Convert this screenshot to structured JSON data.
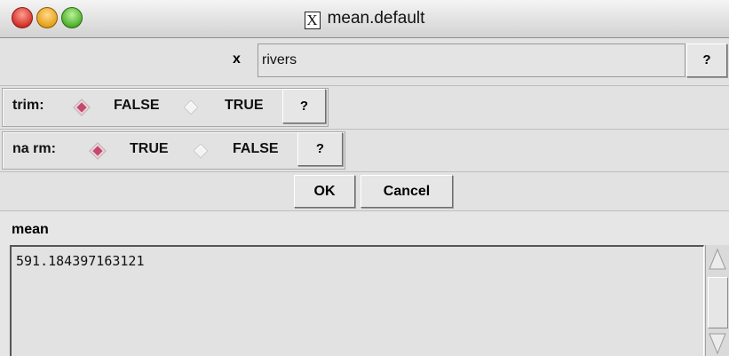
{
  "window": {
    "title": "mean.default",
    "title_icon": "X"
  },
  "x_arg": {
    "label": "x",
    "value": "rivers",
    "help_label": "?"
  },
  "trim": {
    "label": "trim:",
    "options": [
      {
        "label": "FALSE",
        "selected": true
      },
      {
        "label": "TRUE",
        "selected": false
      }
    ],
    "help_label": "?"
  },
  "na_rm": {
    "label": "na rm:",
    "options": [
      {
        "label": "TRUE",
        "selected": true
      },
      {
        "label": "FALSE",
        "selected": false
      }
    ],
    "help_label": "?"
  },
  "actions": {
    "ok_label": "OK",
    "cancel_label": "Cancel"
  },
  "result": {
    "label": "mean",
    "value": "591.184397163121"
  },
  "colors": {
    "radio_selected": "#c14a6d",
    "background": "#e2e2e2"
  }
}
